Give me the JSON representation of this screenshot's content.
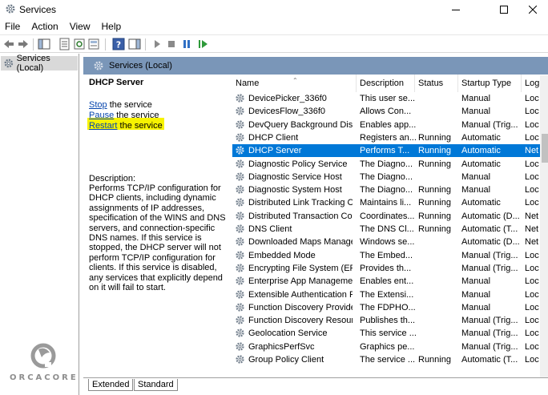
{
  "window": {
    "title": "Services"
  },
  "menu": [
    "File",
    "Action",
    "View",
    "Help"
  ],
  "tree": {
    "selected_label": "Services (Local)"
  },
  "header": {
    "title": "Services (Local)"
  },
  "details": {
    "service_name": "DHCP Server",
    "actions": [
      {
        "link": "Stop",
        "rest": " the service"
      },
      {
        "link": "Pause",
        "rest": " the service"
      },
      {
        "link": "Restart",
        "rest": " the service"
      }
    ],
    "description_label": "Description:",
    "description": "Performs TCP/IP configuration for DHCP clients, including dynamic assignments of IP addresses, specification of the WINS and DNS servers, and connection-specific DNS names. If this service is stopped, the DHCP server will not perform TCP/IP configuration for clients. If this service is disabled, any services that explicitly depend on it will fail to start."
  },
  "columns": [
    "Name",
    "Description",
    "Status",
    "Startup Type",
    "Log"
  ],
  "rows": [
    {
      "name": "DevicePicker_336f0",
      "desc": "This user se...",
      "status": "",
      "startup": "Manual",
      "logon": "Loc"
    },
    {
      "name": "DevicesFlow_336f0",
      "desc": "Allows Con...",
      "status": "",
      "startup": "Manual",
      "logon": "Loc"
    },
    {
      "name": "DevQuery Background Disc...",
      "desc": "Enables app...",
      "status": "",
      "startup": "Manual (Trig...",
      "logon": "Loc"
    },
    {
      "name": "DHCP Client",
      "desc": "Registers an...",
      "status": "Running",
      "startup": "Automatic",
      "logon": "Loc"
    },
    {
      "name": "DHCP Server",
      "desc": "Performs T...",
      "status": "Running",
      "startup": "Automatic",
      "logon": "Net",
      "selected": true
    },
    {
      "name": "Diagnostic Policy Service",
      "desc": "The Diagno...",
      "status": "Running",
      "startup": "Automatic",
      "logon": "Loc"
    },
    {
      "name": "Diagnostic Service Host",
      "desc": "The Diagno...",
      "status": "",
      "startup": "Manual",
      "logon": "Loc"
    },
    {
      "name": "Diagnostic System Host",
      "desc": "The Diagno...",
      "status": "Running",
      "startup": "Manual",
      "logon": "Loc"
    },
    {
      "name": "Distributed Link Tracking Cl...",
      "desc": "Maintains li...",
      "status": "Running",
      "startup": "Automatic",
      "logon": "Loc"
    },
    {
      "name": "Distributed Transaction Coo...",
      "desc": "Coordinates...",
      "status": "Running",
      "startup": "Automatic (D...",
      "logon": "Net"
    },
    {
      "name": "DNS Client",
      "desc": "The DNS Cl...",
      "status": "Running",
      "startup": "Automatic (T...",
      "logon": "Net"
    },
    {
      "name": "Downloaded Maps Manager",
      "desc": "Windows se...",
      "status": "",
      "startup": "Automatic (D...",
      "logon": "Net"
    },
    {
      "name": "Embedded Mode",
      "desc": "The Embed...",
      "status": "",
      "startup": "Manual (Trig...",
      "logon": "Loc"
    },
    {
      "name": "Encrypting File System (EFS)",
      "desc": "Provides th...",
      "status": "",
      "startup": "Manual (Trig...",
      "logon": "Loc"
    },
    {
      "name": "Enterprise App Managemen...",
      "desc": "Enables ent...",
      "status": "",
      "startup": "Manual",
      "logon": "Loc"
    },
    {
      "name": "Extensible Authentication P...",
      "desc": "The Extensi...",
      "status": "",
      "startup": "Manual",
      "logon": "Loc"
    },
    {
      "name": "Function Discovery Provide...",
      "desc": "The FDPHO...",
      "status": "",
      "startup": "Manual",
      "logon": "Loc"
    },
    {
      "name": "Function Discovery Resourc...",
      "desc": "Publishes th...",
      "status": "",
      "startup": "Manual (Trig...",
      "logon": "Loc"
    },
    {
      "name": "Geolocation Service",
      "desc": "This service ...",
      "status": "",
      "startup": "Manual (Trig...",
      "logon": "Loc"
    },
    {
      "name": "GraphicsPerfSvc",
      "desc": "Graphics pe...",
      "status": "",
      "startup": "Manual (Trig...",
      "logon": "Loc"
    },
    {
      "name": "Group Policy Client",
      "desc": "The service ...",
      "status": "Running",
      "startup": "Automatic (T...",
      "logon": "Loc"
    }
  ],
  "tabs": [
    "Extended",
    "Standard"
  ],
  "watermark": "ORCACORE"
}
